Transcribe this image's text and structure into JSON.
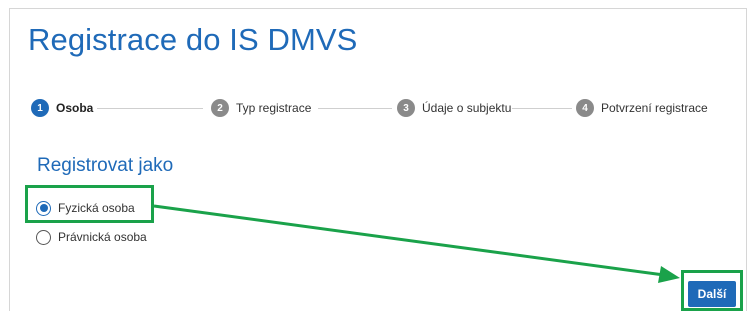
{
  "page": {
    "title": "Registrace do IS DMVS"
  },
  "steps": [
    {
      "number": "1",
      "label": "Osoba",
      "active": true
    },
    {
      "number": "2",
      "label": "Typ registrace",
      "active": false
    },
    {
      "number": "3",
      "label": "Údaje o subjektu",
      "active": false
    },
    {
      "number": "4",
      "label": "Potvrzení registrace",
      "active": false
    }
  ],
  "form": {
    "section_title": "Registrovat jako",
    "options": [
      {
        "label": "Fyzická osoba",
        "selected": true
      },
      {
        "label": "Právnická osoba",
        "selected": false
      }
    ]
  },
  "actions": {
    "next_label": "Další"
  },
  "colors": {
    "accent": "#1f6ab8",
    "step_inactive": "#8a8a8a",
    "annotation": "#1aa24a"
  }
}
